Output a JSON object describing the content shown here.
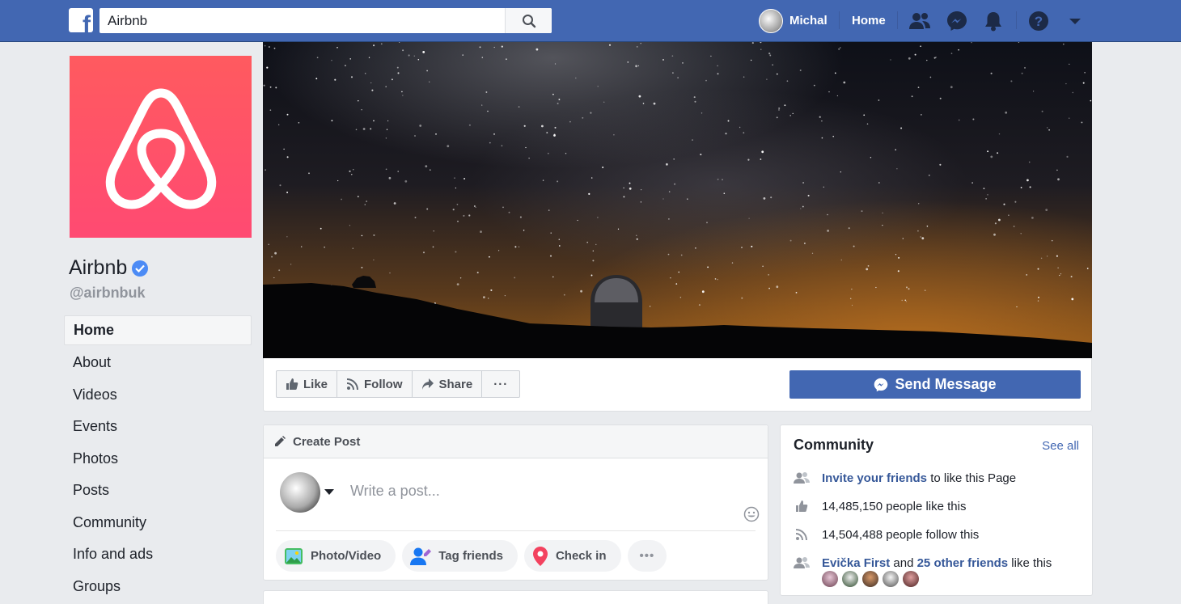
{
  "topbar": {
    "logo_letter": "f",
    "search_value": "Airbnb",
    "user_name": "Michal",
    "home_label": "Home",
    "brand_color": "#4267b2"
  },
  "page": {
    "name": "Airbnb",
    "handle": "@airbnbuk",
    "brand_color": "#ff5a5f"
  },
  "left_nav": {
    "items": [
      {
        "label": "Home"
      },
      {
        "label": "About"
      },
      {
        "label": "Videos"
      },
      {
        "label": "Events"
      },
      {
        "label": "Photos"
      },
      {
        "label": "Posts"
      },
      {
        "label": "Community"
      },
      {
        "label": "Info and ads"
      },
      {
        "label": "Groups"
      }
    ]
  },
  "actions": {
    "like": "Like",
    "follow": "Follow",
    "share": "Share",
    "more": "···",
    "send_message": "Send Message"
  },
  "create_post": {
    "header": "Create Post",
    "placeholder": "Write a post...",
    "chips": {
      "photo_video": "Photo/Video",
      "tag_friends": "Tag friends",
      "check_in": "Check in",
      "more": "•••"
    }
  },
  "community": {
    "title": "Community",
    "see_all": "See all",
    "invite_link": "Invite your friends",
    "invite_rest": " to like this Page",
    "likes": "14,485,150 people like this",
    "follows": "14,504,488 people follow this",
    "friend_name": "Evička First",
    "friend_and": " and ",
    "friend_others": "25 other friends",
    "friend_rest": " like this"
  }
}
